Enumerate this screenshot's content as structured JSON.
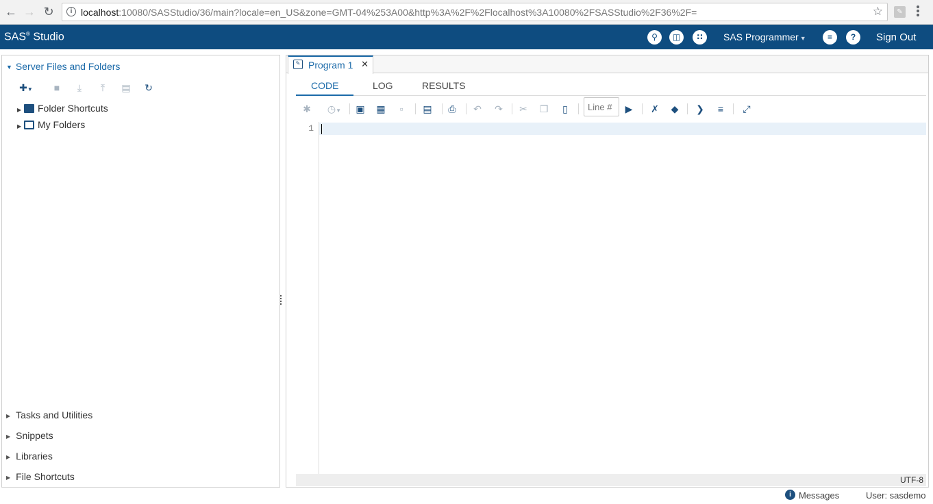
{
  "browser": {
    "url_host": "localhost",
    "url_rest": ":10080/SASStudio/36/main?locale=en_US&zone=GMT-04%253A00&http%3A%2F%2Flocalhost%3A10080%2FSASStudio%2F36%2F="
  },
  "header": {
    "title": "SAS",
    "title_suffix": " Studio",
    "role": "SAS Programmer",
    "sign_out": "Sign Out"
  },
  "left_panel": {
    "section_title": "Server Files and Folders",
    "tree": [
      "Folder Shortcuts",
      "My Folders"
    ],
    "accordion": [
      "Tasks and Utilities",
      "Snippets",
      "Libraries",
      "File Shortcuts"
    ]
  },
  "editor": {
    "tab_label": "Program 1",
    "subtabs": [
      "CODE",
      "LOG",
      "RESULTS"
    ],
    "line_placeholder": "Line #",
    "line_numbers": [
      "1"
    ],
    "encoding": "UTF-8"
  },
  "status": {
    "messages": "Messages",
    "user": "User: sasdemo"
  },
  "colors": {
    "header_bg": "#0e4c80",
    "accent": "#1b6aa9"
  }
}
